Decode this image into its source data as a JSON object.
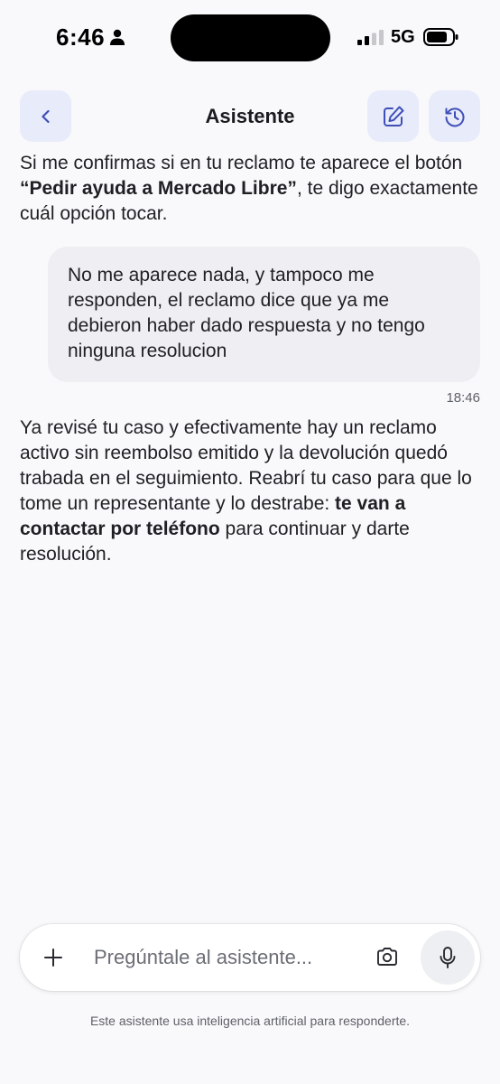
{
  "status_bar": {
    "time": "6:46",
    "network": "5G"
  },
  "header": {
    "title": "Asistente",
    "icons": {
      "back": "chevron-left-icon",
      "edit": "edit-icon",
      "history": "history-icon"
    }
  },
  "messages": [
    {
      "role": "assistant",
      "parts": [
        {
          "text": "Si me confirmas si en tu reclamo te aparece el botón ",
          "bold": false
        },
        {
          "text": "“Pedir ayuda a Mercado Libre”",
          "bold": true
        },
        {
          "text": ", te digo exactamente cuál opción tocar.",
          "bold": false
        }
      ]
    },
    {
      "role": "user",
      "text": "No me aparece nada, y tampoco me responden, el reclamo dice que ya me debieron haber dado respuesta y no tengo ninguna resolucion",
      "time": "18:46"
    },
    {
      "role": "assistant",
      "parts": [
        {
          "text": "Ya revisé tu caso y efectivamente hay un reclamo activo sin reembolso emitido y la devolución quedó trabada en el seguimiento. Reabrí tu caso para que lo tome un representante y lo destrabe: ",
          "bold": false
        },
        {
          "text": "te van a contactar por teléfono",
          "bold": true
        },
        {
          "text": " para continuar y darte resolución.",
          "bold": false
        }
      ]
    }
  ],
  "composer": {
    "placeholder": "Pregúntale al asistente...",
    "value": "",
    "icons": {
      "plus": "plus-icon",
      "camera": "camera-icon",
      "mic": "microphone-icon"
    }
  },
  "disclaimer": "Este asistente usa inteligencia artificial para responderte.",
  "colors": {
    "background": "#f9f9fb",
    "header_button_bg": "#e8ebfa",
    "accent_icon": "#3f4fb8",
    "user_bubble": "#efeff3"
  }
}
